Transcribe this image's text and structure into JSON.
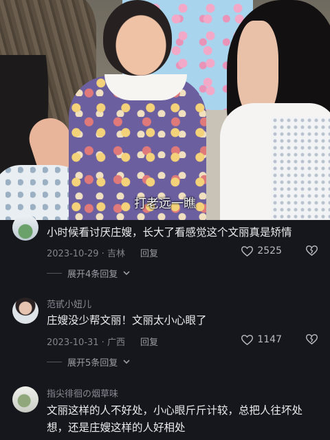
{
  "video": {
    "subtitle": "打老远一瞧"
  },
  "comments": [
    {
      "username": "",
      "text": "小时候看讨厌庄嫂，长大了看感觉这个文丽真是矫情",
      "date_location": "2023-10-29 · 吉林",
      "reply_label": "回复",
      "likes": "2525",
      "expand_label": "展开4条回复"
    },
    {
      "username": "范甙小妞儿",
      "text": "庄嫂没少帮文丽！文丽太小心眼了",
      "date_location": "2023-10-31 · 广西",
      "reply_label": "回复",
      "likes": "1147",
      "expand_label": "展开5条回复"
    },
    {
      "username": "指尖徘徊の烟草味",
      "text": "文丽这样的人不好处，小心眼斤斤计较，总把人往坏处想，还是庄嫂这样的人好相处"
    }
  ],
  "colors": {
    "background": "#16171c",
    "text_primary": "#ececee",
    "text_secondary": "#83848c"
  }
}
